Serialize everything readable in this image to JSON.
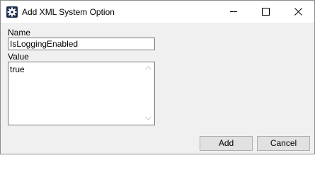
{
  "window": {
    "title": "Add XML System Option",
    "icon": "gear-icon",
    "caption_buttons": [
      "minimize-icon",
      "maximize-icon",
      "close-icon"
    ]
  },
  "form": {
    "name_label": "Name",
    "name_value": "IsLoggingEnabled",
    "value_label": "Value",
    "value_text": "true"
  },
  "buttons": {
    "add_label": "Add",
    "cancel_label": "Cancel"
  },
  "colors": {
    "titlebar_bg": "#ffffff",
    "dialog_bg": "#f0f0f0",
    "button_bg": "#e1e1e1",
    "button_border": "#adadad",
    "input_border": "#7a7a7a",
    "icon_bg": "#1f2f4d"
  }
}
